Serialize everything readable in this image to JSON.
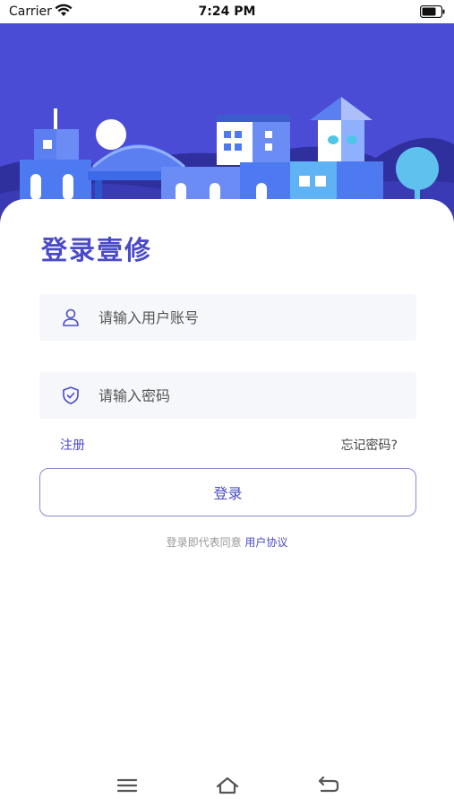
{
  "status": {
    "carrier": "Carrier",
    "time": "7:24 PM"
  },
  "login": {
    "title": "登录壹修",
    "username_placeholder": "请输入用户账号",
    "password_placeholder": "请输入密码",
    "register_label": "注册",
    "forgot_label": "忘记密码?",
    "login_button": "登录",
    "agreement_prefix": "登录即代表同意 ",
    "agreement_link": "用户协议"
  },
  "colors": {
    "brand": "#4a4bc8",
    "banner": "#4a4cd6"
  },
  "icons": {
    "username": "user-icon",
    "password": "shield-check-icon",
    "nav_menu": "menu-icon",
    "nav_home": "home-icon",
    "nav_back": "back-icon"
  }
}
